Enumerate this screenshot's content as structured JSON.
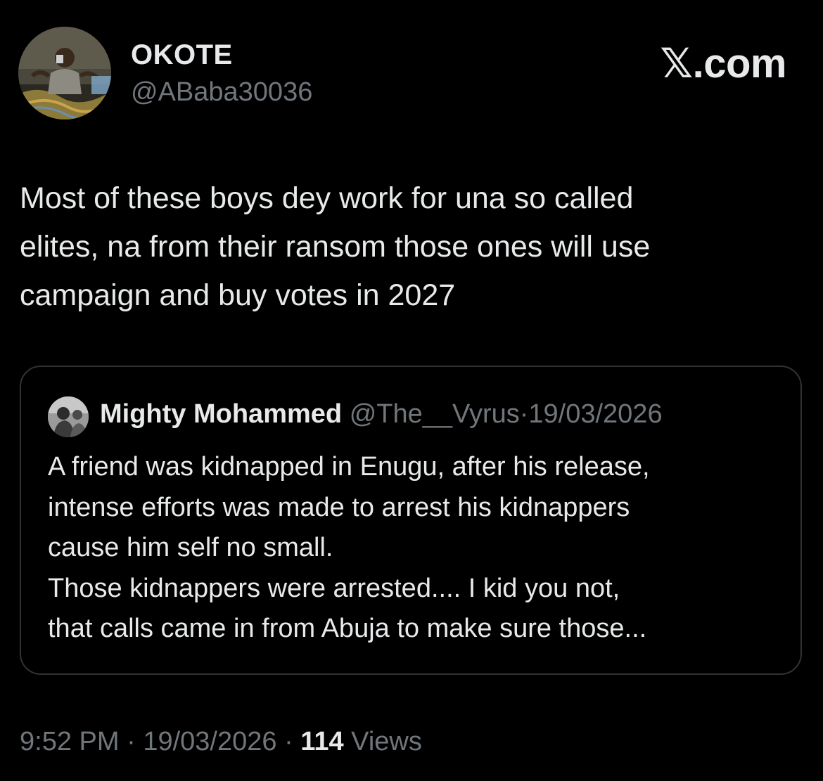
{
  "author": {
    "display_name": "OKOTE",
    "handle": "@ABaba30036",
    "avatar_icon": "profile-photo"
  },
  "brand": {
    "x_glyph": "𝕏",
    "suffix": ".com"
  },
  "tweet": {
    "text": "Most of these boys dey work for una so called\nelites, na from their ransom those ones will use\ncampaign and buy votes in 2027"
  },
  "quoted_tweet": {
    "display_name": "Mighty Mohammed",
    "handle": "@The__Vyrus",
    "separator": "·",
    "date": "19/03/2026",
    "text": "A friend was kidnapped in Enugu, after his release,\nintense efforts was made to arrest his kidnappers\ncause him self no small.\nThose kidnappers were arrested.... I kid you not,\nthat calls came in from Abuja to make sure those..."
  },
  "meta": {
    "time": "9:52 PM",
    "separator": "·",
    "date": "19/03/2026",
    "views_count": "114",
    "views_label": "Views"
  },
  "colors": {
    "background": "#000000",
    "primary_text": "#e7e9ea",
    "secondary_text": "#71767b",
    "border": "#2f3336"
  }
}
